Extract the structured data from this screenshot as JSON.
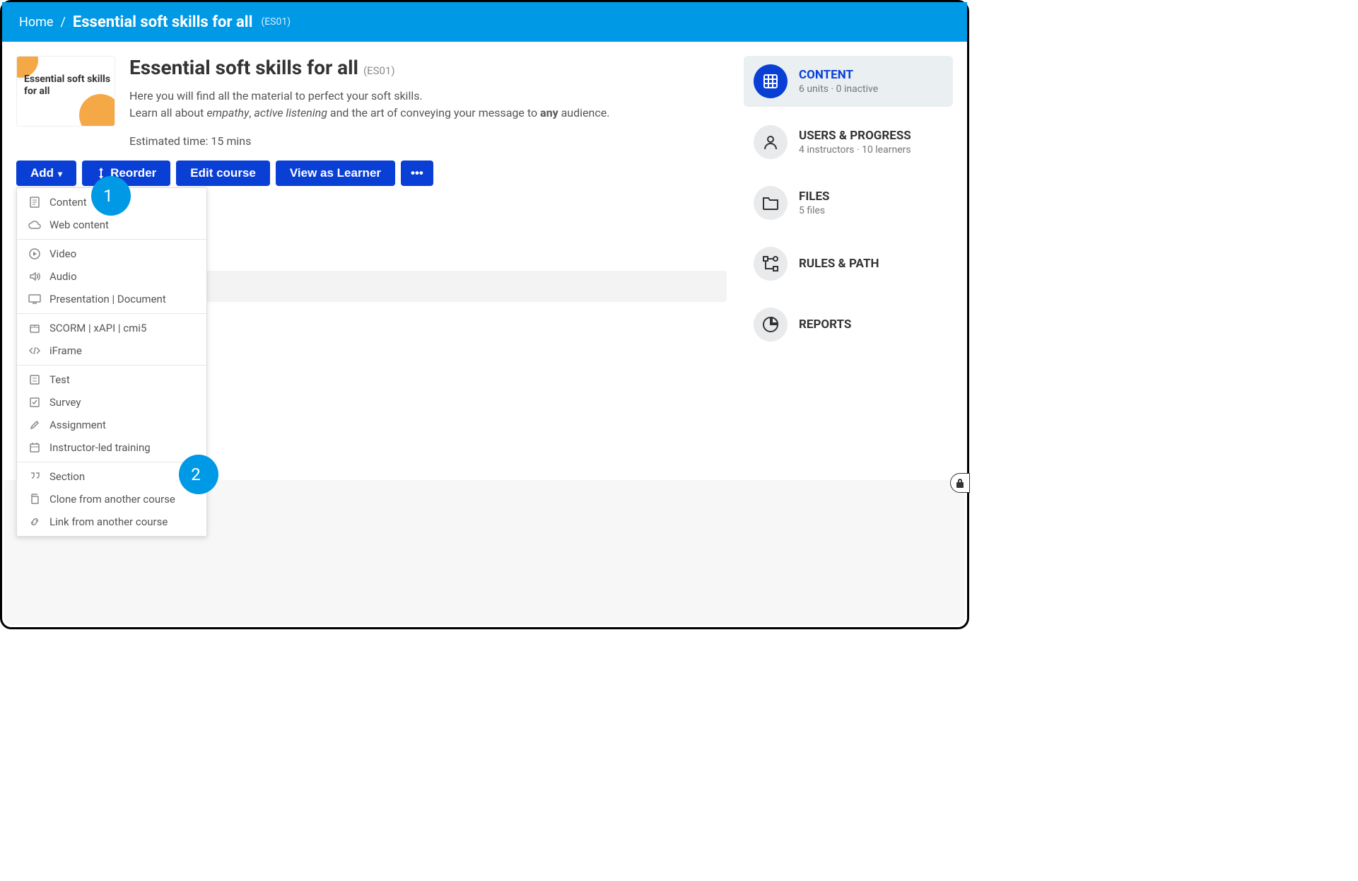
{
  "breadcrumb": {
    "home": "Home",
    "title": "Essential soft skills for all",
    "code": "(ES01)"
  },
  "course": {
    "thumb_text": "Essential soft skills for all",
    "title": "Essential soft skills for all",
    "code": "(ES01)",
    "desc_line1_pre": "Here you will find all the material to perfect your soft skills.",
    "desc_line2_pre": "Learn all about ",
    "desc_em1": "empathy",
    "desc_sep": ", ",
    "desc_em2": "active listening",
    "desc_line2_mid": " and the art of conveying your message to ",
    "desc_strong": "any",
    "desc_line2_post": " audience.",
    "est_time": "Estimated time: 15 mins"
  },
  "toolbar": {
    "add": "Add",
    "reorder": "Reorder",
    "edit": "Edit course",
    "view_as": "View as Learner",
    "more": "•••"
  },
  "add_menu": {
    "groups": [
      {
        "items": [
          {
            "icon": "doc",
            "label": "Content"
          },
          {
            "icon": "cloud",
            "label": "Web content"
          }
        ]
      },
      {
        "items": [
          {
            "icon": "play",
            "label": "Video"
          },
          {
            "icon": "sound",
            "label": "Audio"
          },
          {
            "icon": "screen",
            "label": "Presentation | Document"
          }
        ]
      },
      {
        "items": [
          {
            "icon": "box",
            "label": "SCORM | xAPI | cmi5"
          },
          {
            "icon": "code",
            "label": "iFrame"
          }
        ]
      },
      {
        "items": [
          {
            "icon": "list",
            "label": "Test"
          },
          {
            "icon": "check",
            "label": "Survey"
          },
          {
            "icon": "pen",
            "label": "Assignment"
          },
          {
            "icon": "cal",
            "label": "Instructor-led training"
          }
        ]
      },
      {
        "items": [
          {
            "icon": "quote",
            "label": "Section"
          },
          {
            "icon": "copy",
            "label": "Clone from another course"
          },
          {
            "icon": "link",
            "label": "Link from another course"
          }
        ]
      }
    ]
  },
  "sidebar": {
    "items": [
      {
        "key": "content",
        "title": "CONTENT",
        "sub": "6 units · 0 inactive",
        "icon": "grid",
        "active": true
      },
      {
        "key": "users",
        "title": "USERS & PROGRESS",
        "sub": "4 instructors · 10 learners",
        "icon": "user",
        "active": false
      },
      {
        "key": "files",
        "title": "FILES",
        "sub": "5 files",
        "icon": "folder",
        "active": false
      },
      {
        "key": "rules",
        "title": "RULES & PATH",
        "sub": "",
        "icon": "path",
        "active": false
      },
      {
        "key": "reports",
        "title": "REPORTS",
        "sub": "",
        "icon": "pie",
        "active": false
      }
    ]
  },
  "callouts": {
    "c1": "1",
    "c2": "2"
  }
}
